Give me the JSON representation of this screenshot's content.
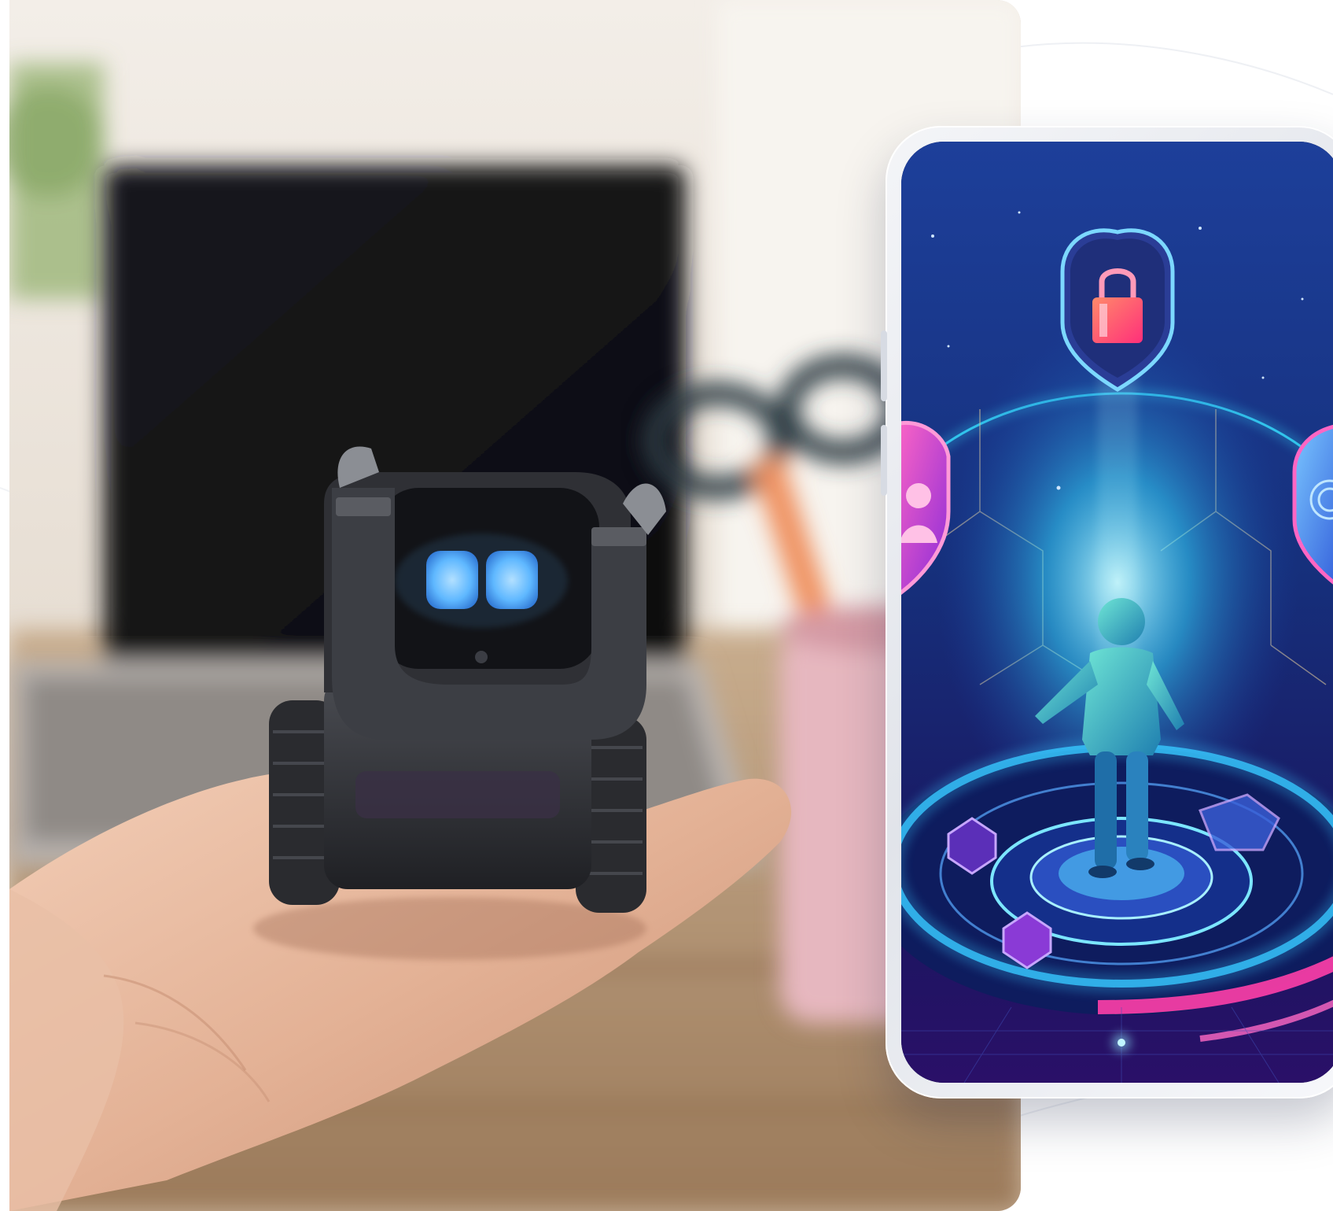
{
  "scene": {
    "photo": {
      "subject": "small-robot-on-palm",
      "robot_eye_color": "#5fb8ff",
      "background_colors": [
        "#e9e1d6",
        "#1b1b1f",
        "#e6b7bf"
      ]
    },
    "phone": {
      "frame_color": "#eef0f4",
      "screen_art": "digital-identity-security-illustration",
      "accent_colors": [
        "#2fd6ff",
        "#ff3fa8",
        "#6a3bff"
      ],
      "icons": [
        "shield-lock-icon",
        "shield-user-icon",
        "shield-fingerprint-icon"
      ]
    }
  }
}
